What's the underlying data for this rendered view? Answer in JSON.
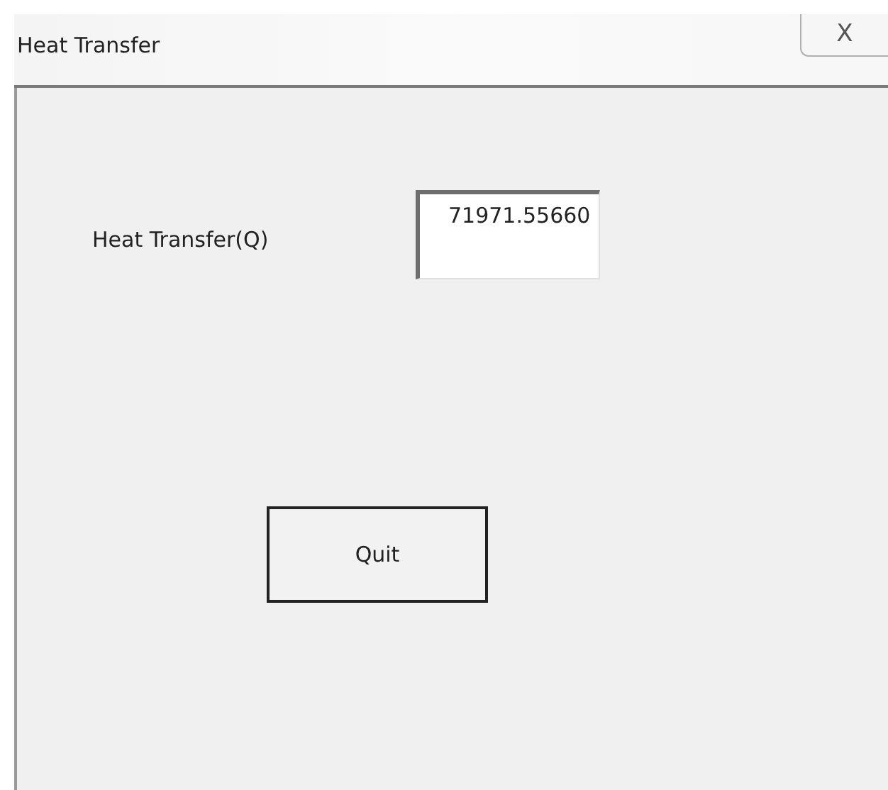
{
  "window": {
    "title": "Heat Transfer",
    "close": "X"
  },
  "field": {
    "label": "Heat Transfer(Q)",
    "value": "71971.55660"
  },
  "buttons": [
    "Quit"
  ]
}
